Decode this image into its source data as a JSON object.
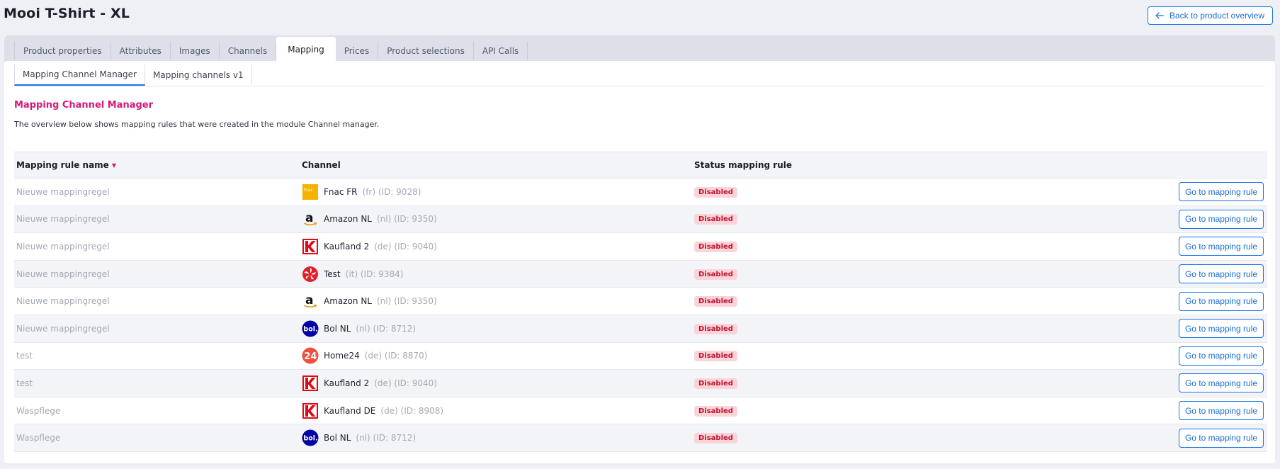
{
  "page": {
    "title": "Mooi T-Shirt - XL",
    "back_label": "Back to product overview"
  },
  "tabs": [
    {
      "label": "Product properties"
    },
    {
      "label": "Attributes"
    },
    {
      "label": "Images"
    },
    {
      "label": "Channels"
    },
    {
      "label": "Mapping",
      "active": true
    },
    {
      "label": "Prices"
    },
    {
      "label": "Product selections"
    },
    {
      "label": "API Calls"
    }
  ],
  "subtabs": [
    {
      "label": "Mapping Channel Manager",
      "active": true
    },
    {
      "label": "Mapping channels v1"
    }
  ],
  "section": {
    "title": "Mapping Channel Manager",
    "description": "The overview below shows mapping rules that were created in the module Channel manager."
  },
  "table": {
    "headers": {
      "rule_name": "Mapping rule name",
      "channel": "Channel",
      "status": "Status mapping rule"
    },
    "rows": [
      {
        "rule": "Nieuwe mappingregel",
        "channel": "Fnac FR",
        "meta": "(fr) (ID: 9028)",
        "icon": "fnac-logo-icon",
        "status": "Disabled",
        "action": "Go to mapping rule"
      },
      {
        "rule": "Nieuwe mappingregel",
        "channel": "Amazon NL",
        "meta": "(nl) (ID: 9350)",
        "icon": "amazon-logo-icon",
        "status": "Disabled",
        "action": "Go to mapping rule"
      },
      {
        "rule": "Nieuwe mappingregel",
        "channel": "Kaufland 2",
        "meta": "(de) (ID: 9040)",
        "icon": "kaufland-logo-icon",
        "status": "Disabled",
        "action": "Go to mapping rule"
      },
      {
        "rule": "Nieuwe mappingregel",
        "channel": "Test",
        "meta": "(it) (ID: 9384)",
        "icon": "test-channel-logo-icon",
        "status": "Disabled",
        "action": "Go to mapping rule"
      },
      {
        "rule": "Nieuwe mappingregel",
        "channel": "Amazon NL",
        "meta": "(nl) (ID: 9350)",
        "icon": "amazon-logo-icon",
        "status": "Disabled",
        "action": "Go to mapping rule"
      },
      {
        "rule": "Nieuwe mappingregel",
        "channel": "Bol NL",
        "meta": "(nl) (ID: 8712)",
        "icon": "bol-logo-icon",
        "status": "Disabled",
        "action": "Go to mapping rule"
      },
      {
        "rule": "test",
        "channel": "Home24",
        "meta": "(de) (ID: 8870)",
        "icon": "home24-logo-icon",
        "status": "Disabled",
        "action": "Go to mapping rule"
      },
      {
        "rule": "test",
        "channel": "Kaufland 2",
        "meta": "(de) (ID: 9040)",
        "icon": "kaufland-logo-icon",
        "status": "Disabled",
        "action": "Go to mapping rule"
      },
      {
        "rule": "Waspflege",
        "channel": "Kaufland DE",
        "meta": "(de) (ID: 8908)",
        "icon": "kaufland-logo-icon",
        "status": "Disabled",
        "action": "Go to mapping rule"
      },
      {
        "rule": "Waspflege",
        "channel": "Bol NL",
        "meta": "(nl) (ID: 8712)",
        "icon": "bol-logo-icon",
        "status": "Disabled",
        "action": "Go to mapping rule"
      }
    ]
  },
  "colors": {
    "accent": "#1a73e8",
    "section_title": "#d6187b",
    "badge_bg": "#fbd4d9",
    "badge_text": "#c2122e"
  }
}
